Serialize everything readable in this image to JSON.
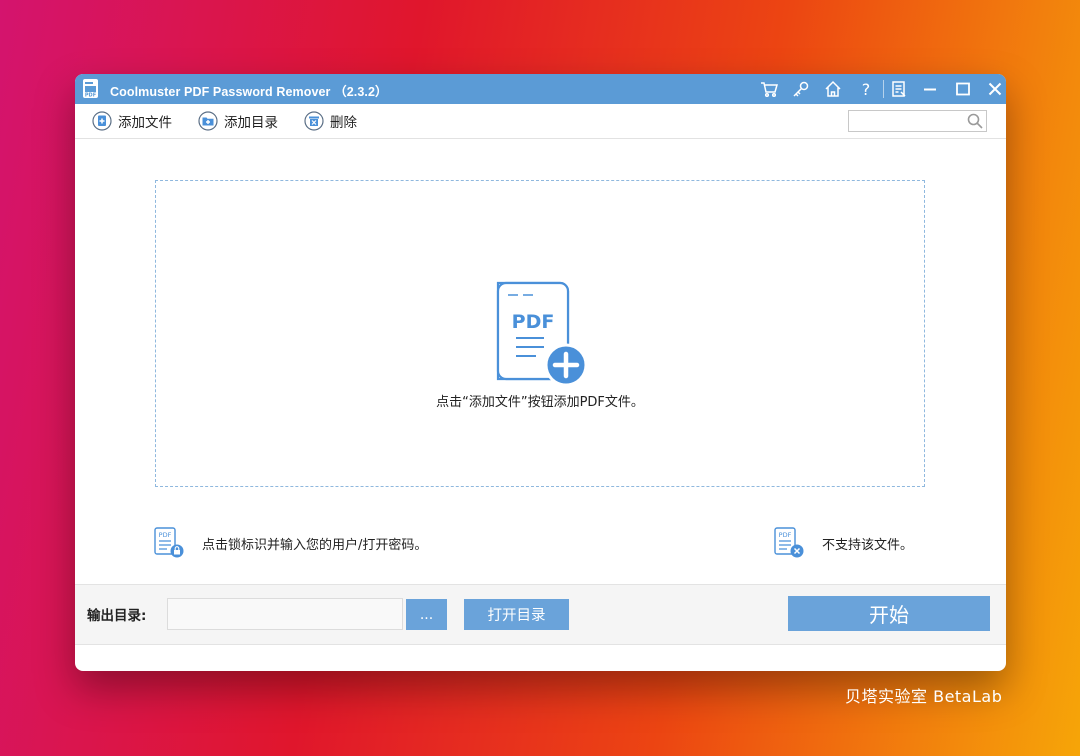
{
  "window": {
    "title": "Coolmuster PDF Password Remover （2.3.2）",
    "title_icons": [
      "cart-icon",
      "key-icon",
      "home-icon",
      "help-icon",
      "feedback-icon",
      "minimize-icon",
      "maximize-icon",
      "close-icon"
    ]
  },
  "toolbar": {
    "add_file_label": "添加文件",
    "add_folder_label": "添加目录",
    "delete_label": "删除",
    "search_value": ""
  },
  "dropzone": {
    "graphic_text": "PDF",
    "hint": "点击“添加文件”按钮添加PDF文件。"
  },
  "legend": {
    "locked_text": "点击锁标识并输入您的用户/打开密码。",
    "locked_icon_text": "PDF",
    "unsupported_text": "不支持该文件。",
    "unsupported_icon_text": "PDF"
  },
  "output": {
    "label": "输出目录:",
    "path_value": "",
    "browse_label": "...",
    "open_label": "打开目录",
    "start_label": "开始"
  },
  "watermark": "贝塔实验室 BetaLab",
  "colors": {
    "titlebar": "#5b9bd6",
    "button": "#6aa3da",
    "accent": "#4a90d9"
  }
}
